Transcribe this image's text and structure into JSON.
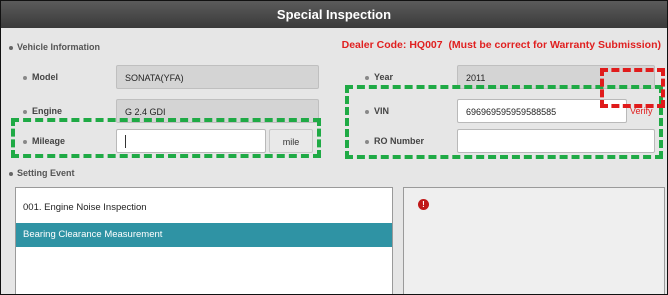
{
  "window": {
    "title": "Special Inspection"
  },
  "vehicle_info": {
    "header": "Vehicle Information",
    "dealer_code_label": "Dealer Code:",
    "dealer_code": "HQ007",
    "dealer_note": "(Must be correct for Warranty Submission)",
    "verify_label": "Verify",
    "fields": {
      "model": {
        "label": "Model",
        "value": "SONATA(YFA)"
      },
      "year": {
        "label": "Year",
        "value": "2011"
      },
      "engine": {
        "label": "Engine",
        "value": "G 2.4 GDI"
      },
      "vin": {
        "label": "VIN",
        "value": "696969595959588585"
      },
      "mileage": {
        "label": "Mileage",
        "value": "",
        "unit": "mile"
      },
      "ro_number": {
        "label": "RO Number",
        "value": ""
      }
    }
  },
  "setting_event": {
    "header": "Setting Event",
    "items": [
      {
        "label": "001. Engine Noise Inspection",
        "selected": false
      },
      {
        "label": "Bearing Clearance Measurement",
        "selected": true
      }
    ]
  },
  "detail": {
    "alert_glyph": "!"
  },
  "colors": {
    "title_bar": "#3f3f3f",
    "accent_selected": "#2f93a4",
    "warning_red": "#e02020",
    "highlight_green": "#1faa45",
    "highlight_red": "#e01b1b"
  }
}
